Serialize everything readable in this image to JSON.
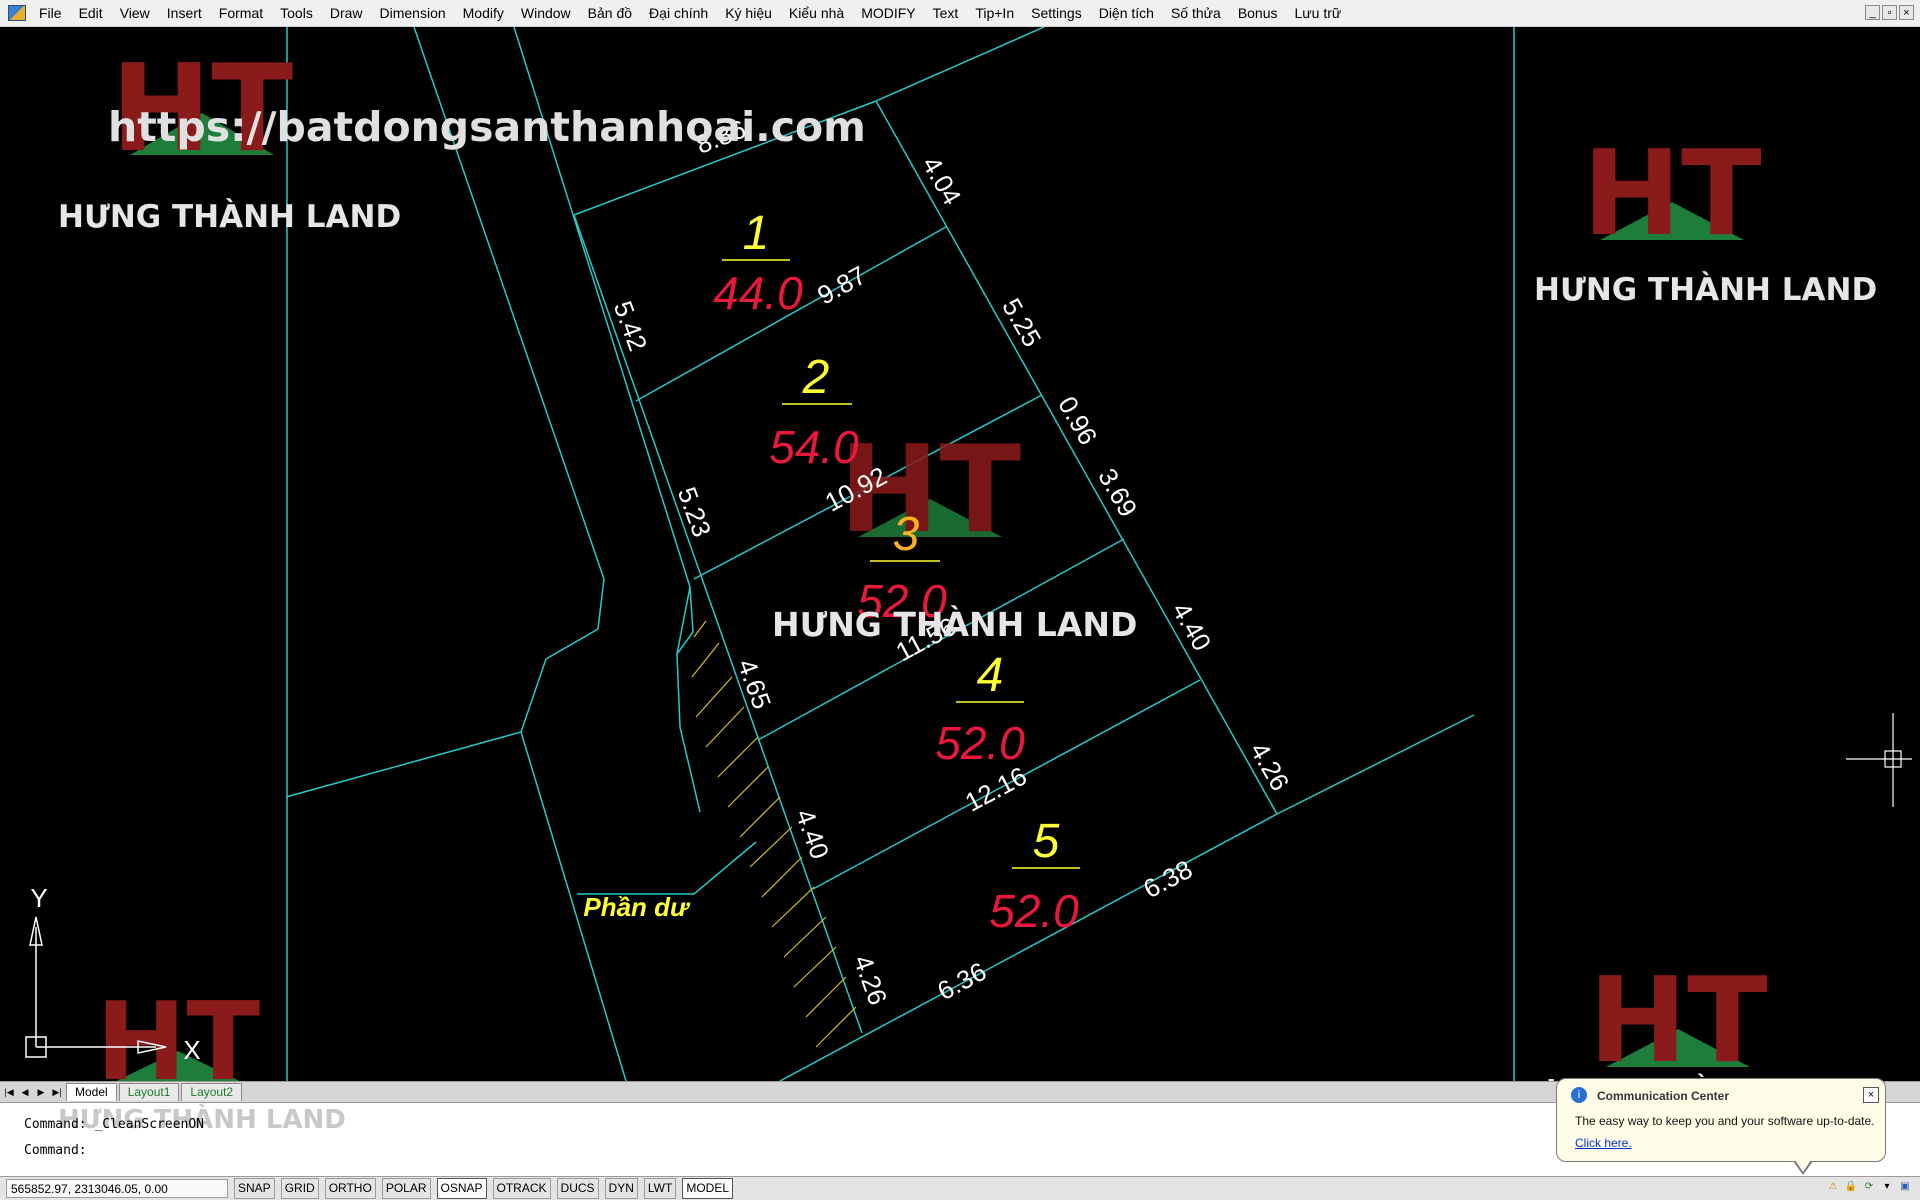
{
  "menu": [
    "File",
    "Edit",
    "View",
    "Insert",
    "Format",
    "Tools",
    "Draw",
    "Dimension",
    "Modify",
    "Window",
    "Bản đồ",
    "Đại chính",
    "Ký hiệu",
    "Kiểu nhà",
    "MODIFY",
    "Text",
    "Tip+In",
    "Settings",
    "Diện tích",
    "Số thửa",
    "Bonus",
    "Lưu trữ"
  ],
  "window_controls": [
    "_",
    "▫",
    "×"
  ],
  "watermark": {
    "url": "https://batdongsanthanhoai.com",
    "brand": "HƯNG THÀNH LAND",
    "logo_letters": "HT",
    "color": "#8b1a1a",
    "base_color": "#1e7d3a"
  },
  "parcels": [
    {
      "number": "1",
      "area": "44.0"
    },
    {
      "number": "2",
      "area": "54.0"
    },
    {
      "number": "3",
      "area": "52.0"
    },
    {
      "number": "4",
      "area": "52.0"
    },
    {
      "number": "5",
      "area": "52.0"
    }
  ],
  "dimensions": [
    "8.86",
    "4.04",
    "9.87",
    "5.42",
    "5.25",
    "0.96",
    "3.69",
    "10.92",
    "5.23",
    "11.56",
    "4.40",
    "4.65",
    "4.26",
    "12.16",
    "4.40",
    "6.38",
    "4.26",
    "6.36"
  ],
  "label_phan_du": "Phần dư",
  "ucs": {
    "x": "X",
    "y": "Y"
  },
  "colors": {
    "lines": "#29c8c8",
    "number": "#ffff33",
    "area": "#e8193c",
    "dim": "#ffffff",
    "hatch": "#d4c21a"
  },
  "tabs": [
    "Model",
    "Layout1",
    "Layout2"
  ],
  "tab_nav": [
    "|◀",
    "◀",
    "▶",
    "▶|"
  ],
  "command_lines": [
    "Command: _CleanScreenON",
    "Command:"
  ],
  "status": {
    "coords": "565852.97, 2313046.05, 0.00",
    "buttons": [
      "SNAP",
      "GRID",
      "ORTHO",
      "POLAR",
      "OSNAP",
      "OTRACK",
      "DUCS",
      "DYN",
      "LWT",
      "MODEL"
    ]
  },
  "notification": {
    "title": "Communication Center",
    "message": "The easy way to keep you and your software up-to-date.",
    "link": "Click here.",
    "close": "×"
  }
}
